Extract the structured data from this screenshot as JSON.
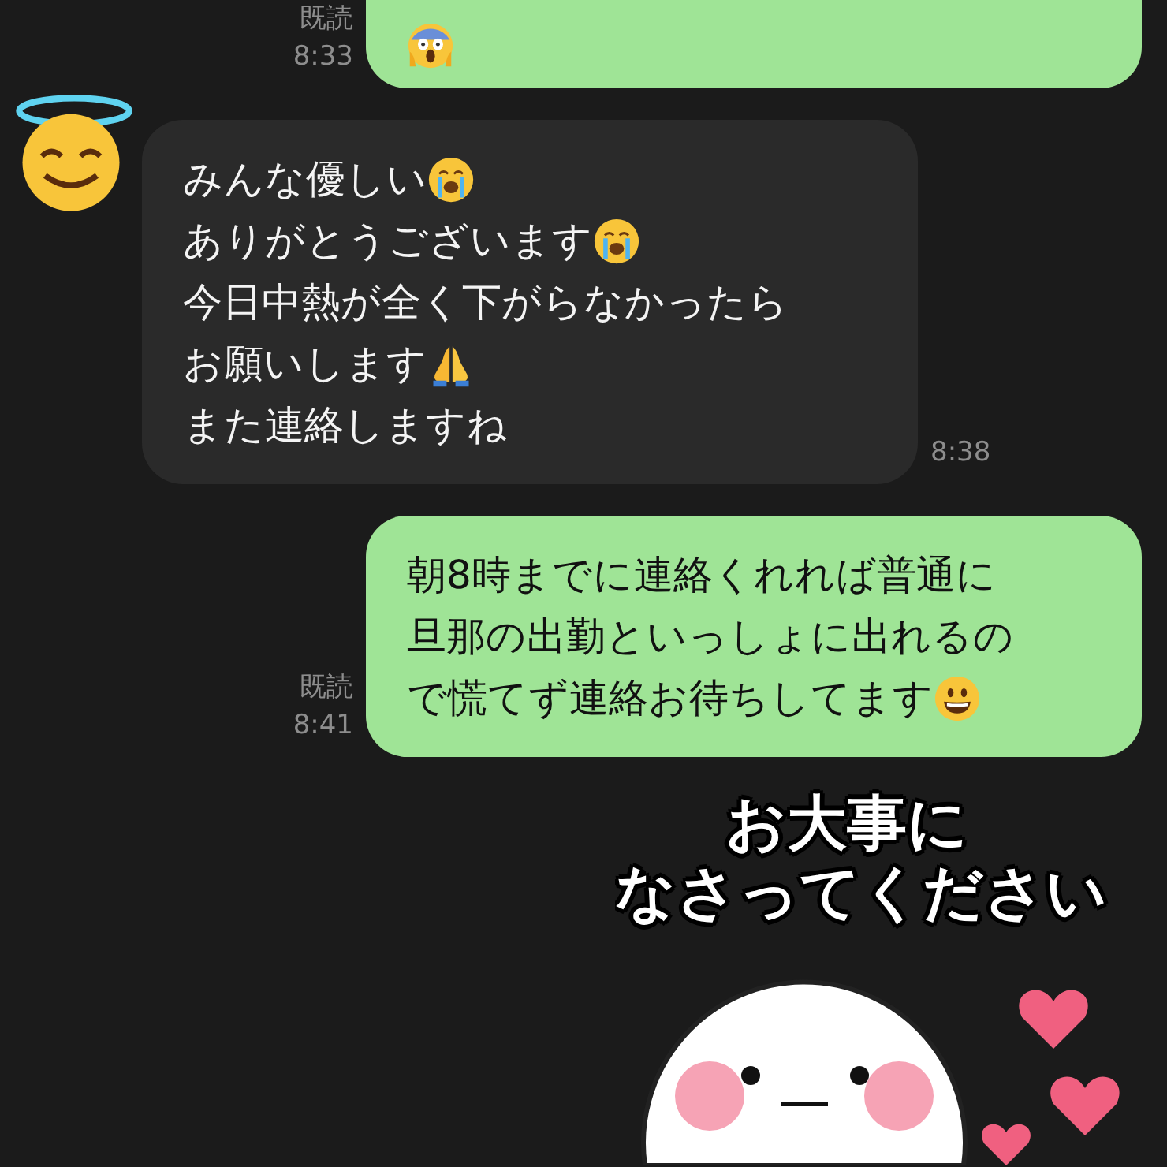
{
  "messages": [
    {
      "kind": "sent",
      "lines": [
        {
          "kind": "scream"
        }
      ],
      "read": "既読",
      "time": "8:33"
    },
    {
      "kind": "received",
      "lines": [
        {
          "text": "みんな優しい",
          "kind": "crying"
        },
        {
          "text": "ありがとうございます",
          "kind": "crying"
        },
        {
          "text": "今日中熱が全く下がらなかったら",
          "kind": "plain"
        },
        {
          "text": "お願いします",
          "kind": "pray"
        },
        {
          "text": "また連絡しますね",
          "kind": "plain"
        }
      ],
      "time": "8:38"
    },
    {
      "kind": "sent",
      "lines": [
        {
          "text": "朝8時までに連絡くれれば普通に",
          "kind": "plain"
        },
        {
          "text": "旦那の出勤といっしょに出れるの",
          "kind": "plain"
        },
        {
          "text": "で慌てず連絡お待ちしてます",
          "kind": "grin"
        }
      ],
      "read": "既読",
      "time": "8:41"
    },
    {
      "kind": "sticker",
      "caption": [
        "お大事に",
        "なさってください"
      ]
    }
  ]
}
